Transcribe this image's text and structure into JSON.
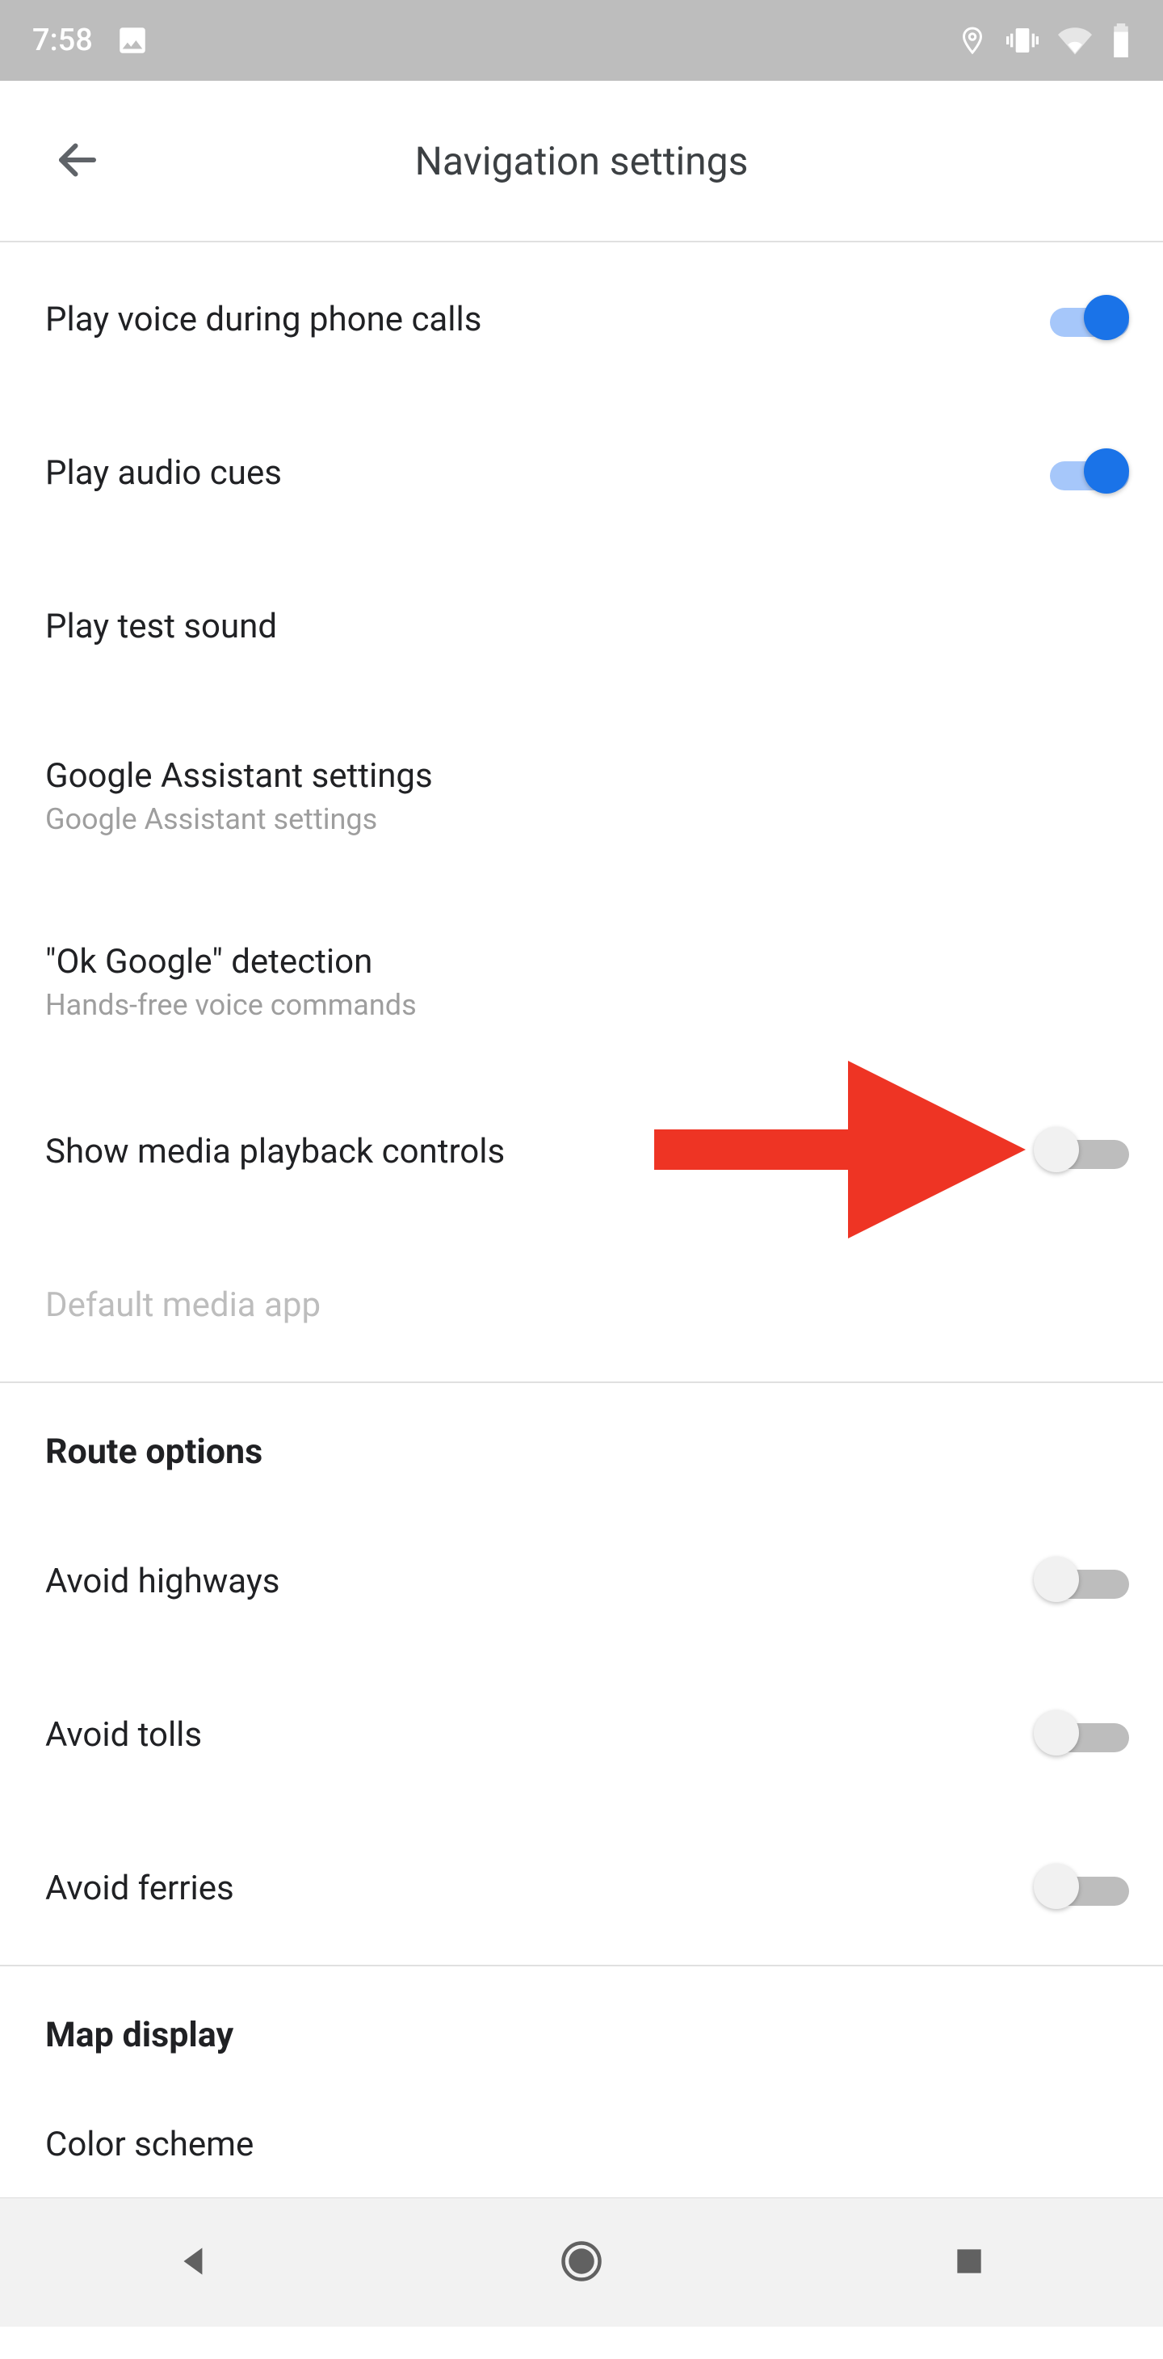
{
  "status": {
    "time": "7:58"
  },
  "header": {
    "title": "Navigation settings"
  },
  "items": {
    "play_voice_calls": {
      "title": "Play voice during phone calls",
      "on": true
    },
    "play_audio_cues": {
      "title": "Play audio cues",
      "on": true
    },
    "play_test_sound": {
      "title": "Play test sound"
    },
    "assistant": {
      "title": "Google Assistant settings",
      "sub": "Google Assistant settings"
    },
    "ok_google": {
      "title": "\"Ok Google\" detection",
      "sub": "Hands-free voice commands"
    },
    "media_controls": {
      "title": "Show media playback controls",
      "on": false
    },
    "default_media": {
      "title": "Default media app"
    },
    "avoid_highways": {
      "title": "Avoid highways",
      "on": false
    },
    "avoid_tolls": {
      "title": "Avoid tolls",
      "on": false
    },
    "avoid_ferries": {
      "title": "Avoid ferries",
      "on": false
    },
    "color_scheme": {
      "title": "Color scheme"
    }
  },
  "sections": {
    "route_options": "Route options",
    "map_display": "Map display"
  }
}
